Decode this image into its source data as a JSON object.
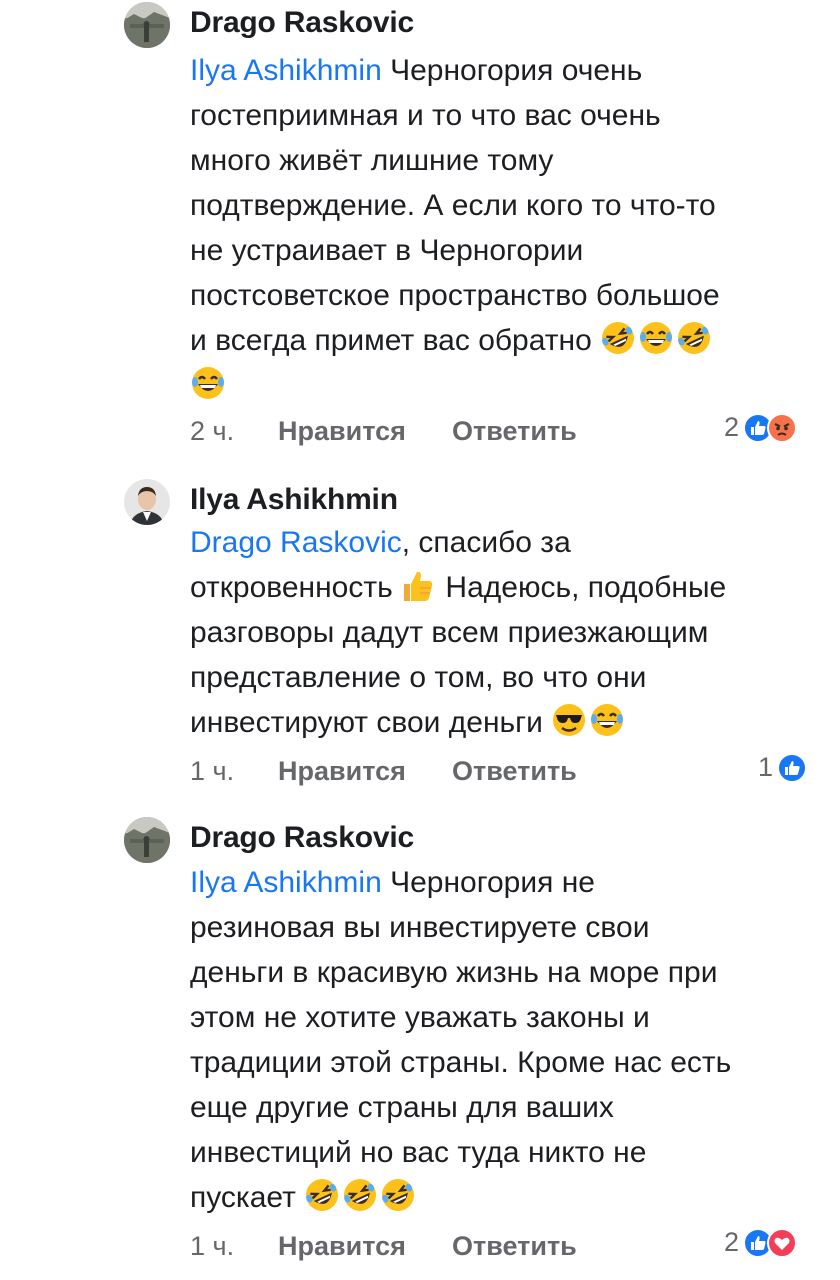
{
  "comments": [
    {
      "author": "Drago Raskovic",
      "avatar": "landscape-photo",
      "mention": "Ilya Ashikhmin",
      "lines": [
        " Черногория очень",
        "гостеприимная и то что вас очень",
        "много живёт лишние тому",
        "подтверждение. А если кого то что-то",
        "не устраивает в Черногории",
        "постсоветское пространство большое",
        "и всегда примет вас обратно "
      ],
      "time": "2 ч.",
      "like_label": "Нравится",
      "reply_label": "Ответить",
      "reaction_count": "2",
      "reactions": [
        "like",
        "angry"
      ]
    },
    {
      "author": "Ilya Ashikhmin",
      "avatar": "portrait-photo",
      "mention": "Drago Raskovic",
      "lines": [
        ", спасибо за",
        "откровенность ",
        "разговоры дадут всем приезжающим",
        "представление о том, во что они",
        "инвестируют свои деньги "
      ],
      "inline_after_thumb": " Надеюсь, подобные",
      "time": "1 ч.",
      "like_label": "Нравится",
      "reply_label": "Ответить",
      "reaction_count": "1",
      "reactions": [
        "like"
      ]
    },
    {
      "author": "Drago Raskovic",
      "avatar": "landscape-photo",
      "mention": "Ilya Ashikhmin",
      "lines": [
        " Черногория не",
        "резиновая вы инвестируете свои",
        "деньги в красивую жизнь на море при",
        "этом не хотите уважать законы  и",
        "традиции этой страны. Кроме нас есть",
        "еще другие страны для ваших",
        "инвестиций но вас туда никто не",
        "пускает "
      ],
      "time": "1 ч.",
      "like_label": "Нравится",
      "reply_label": "Ответить",
      "reaction_count": "2",
      "reactions": [
        "like",
        "love"
      ]
    }
  ],
  "colors": {
    "mention": "#1877f2",
    "meta": "#65676b",
    "like_reaction": "#1877f2",
    "angry_reaction": "#f7714b",
    "love_reaction": "#f33e58",
    "emoji_yellow": "#fcc21b"
  }
}
